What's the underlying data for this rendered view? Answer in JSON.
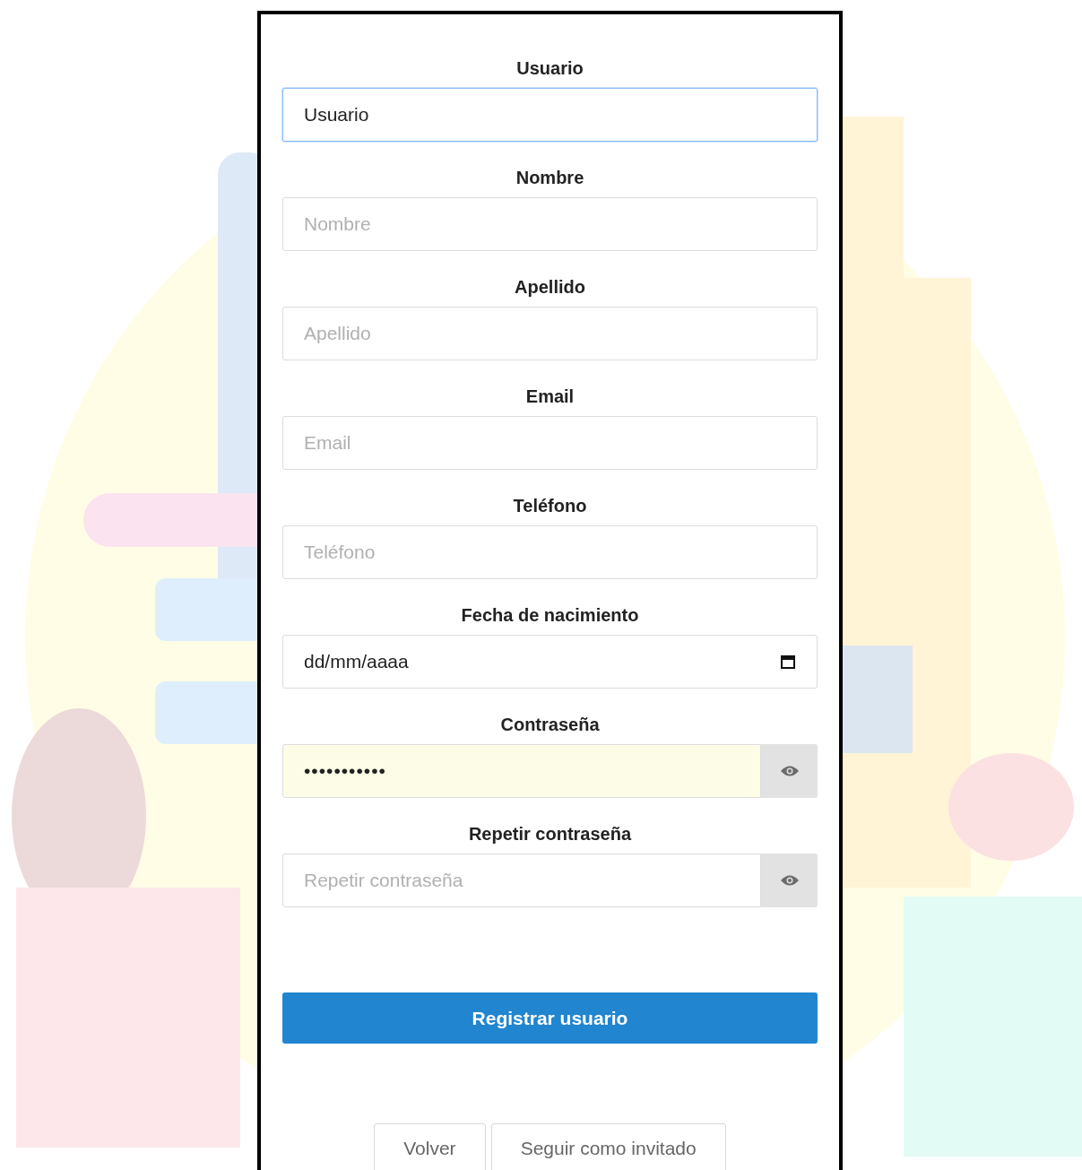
{
  "form": {
    "fields": [
      {
        "kind": "text",
        "label": "Usuario",
        "value": "Usuario",
        "focused": true,
        "autofilled": false
      },
      {
        "kind": "text",
        "label": "Nombre",
        "placeholder": "Nombre",
        "focused": false,
        "autofilled": false
      },
      {
        "kind": "text",
        "label": "Apellido",
        "placeholder": "Apellido",
        "focused": false,
        "autofilled": false
      },
      {
        "kind": "text",
        "label": "Email",
        "placeholder": "Email",
        "focused": false,
        "autofilled": false
      },
      {
        "kind": "text",
        "label": "Teléfono",
        "placeholder": "Teléfono",
        "focused": false,
        "autofilled": false
      },
      {
        "kind": "date",
        "label": "Fecha de nacimiento",
        "value": "dd/mm/aaaa",
        "focused": false,
        "autofilled": false
      },
      {
        "kind": "password",
        "label": "Contraseña",
        "value": "•••••••••••",
        "focused": false,
        "autofilled": true
      },
      {
        "kind": "password",
        "label": "Repetir contraseña",
        "placeholder": "Repetir contraseña",
        "focused": false,
        "autofilled": false
      }
    ],
    "submit": "Registrar usuario",
    "links": [
      "Volver",
      "Seguir como invitado"
    ]
  }
}
